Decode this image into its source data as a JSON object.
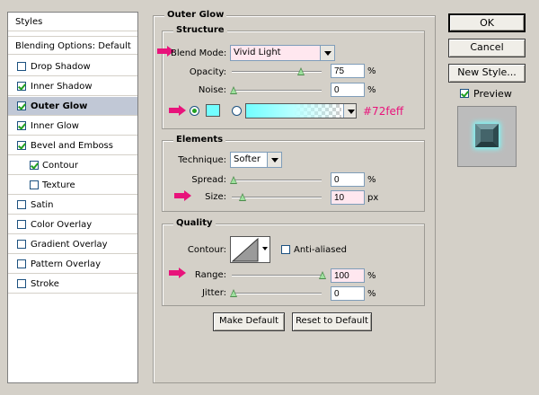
{
  "left_panel": {
    "header": "Styles",
    "blending": "Blending Options: Default",
    "items": [
      {
        "label": "Drop Shadow",
        "checked": false
      },
      {
        "label": "Inner Shadow",
        "checked": true
      },
      {
        "label": "Outer Glow",
        "checked": true
      },
      {
        "label": "Inner Glow",
        "checked": true
      },
      {
        "label": "Bevel and Emboss",
        "checked": true
      },
      {
        "label": "Contour",
        "checked": true
      },
      {
        "label": "Texture",
        "checked": false
      },
      {
        "label": "Satin",
        "checked": false
      },
      {
        "label": "Color Overlay",
        "checked": false
      },
      {
        "label": "Gradient Overlay",
        "checked": false
      },
      {
        "label": "Pattern Overlay",
        "checked": false
      },
      {
        "label": "Stroke",
        "checked": false
      }
    ]
  },
  "outer_glow": {
    "title": "Outer Glow",
    "structure": {
      "title": "Structure",
      "blend_mode_label": "Blend Mode:",
      "blend_mode_value": "Vivid Light",
      "opacity_label": "Opacity:",
      "opacity_value": "75",
      "opacity_fraction": 0.75,
      "noise_label": "Noise:",
      "noise_value": "0",
      "percent": "%",
      "color_hex_note": "#72feff",
      "glow_color": "#72feff"
    },
    "elements": {
      "title": "Elements",
      "technique_label": "Technique:",
      "technique_value": "Softer",
      "spread_label": "Spread:",
      "spread_value": "0",
      "size_label": "Size:",
      "size_value": "10",
      "size_unit": "px",
      "percent": "%"
    },
    "quality": {
      "title": "Quality",
      "contour_label": "Contour:",
      "anti_aliased_label": "Anti-aliased",
      "range_label": "Range:",
      "range_value": "100",
      "jitter_label": "Jitter:",
      "jitter_value": "0",
      "percent": "%"
    },
    "make_default": "Make Default",
    "reset_default": "Reset to Default"
  },
  "right": {
    "ok": "OK",
    "cancel": "Cancel",
    "new_style": "New Style...",
    "preview": "Preview"
  },
  "colors": {
    "accent_arrow": "#e8137b",
    "selected_row": "#c1c8d6"
  }
}
